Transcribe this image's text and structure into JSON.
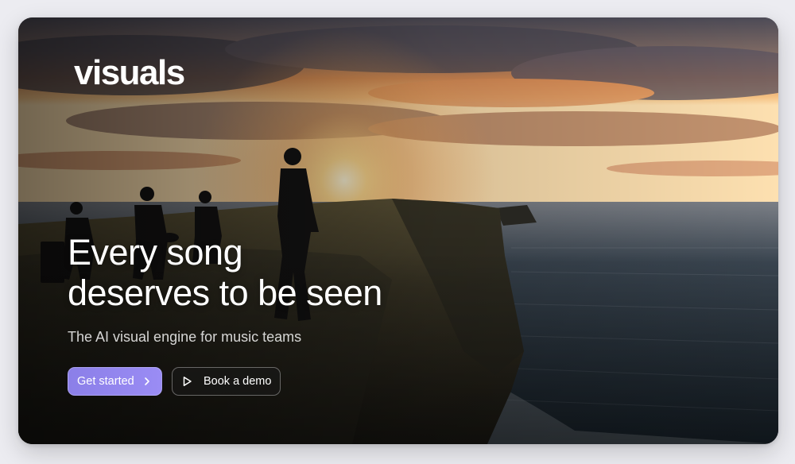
{
  "brand": {
    "logo_text": "visuals"
  },
  "hero": {
    "headline_line1": "Every song",
    "headline_line2": "deserves to be seen",
    "subtitle": "The AI visual engine for music teams"
  },
  "cta": {
    "primary_label": "Get started",
    "primary_icon": "chevron-right-icon",
    "secondary_label": "Book a demo",
    "secondary_icon": "play-icon"
  },
  "colors": {
    "page_background": "#ececf1",
    "primary_button": "#9185ee",
    "secondary_button": "#2a2a2a",
    "text": "#ffffff"
  }
}
